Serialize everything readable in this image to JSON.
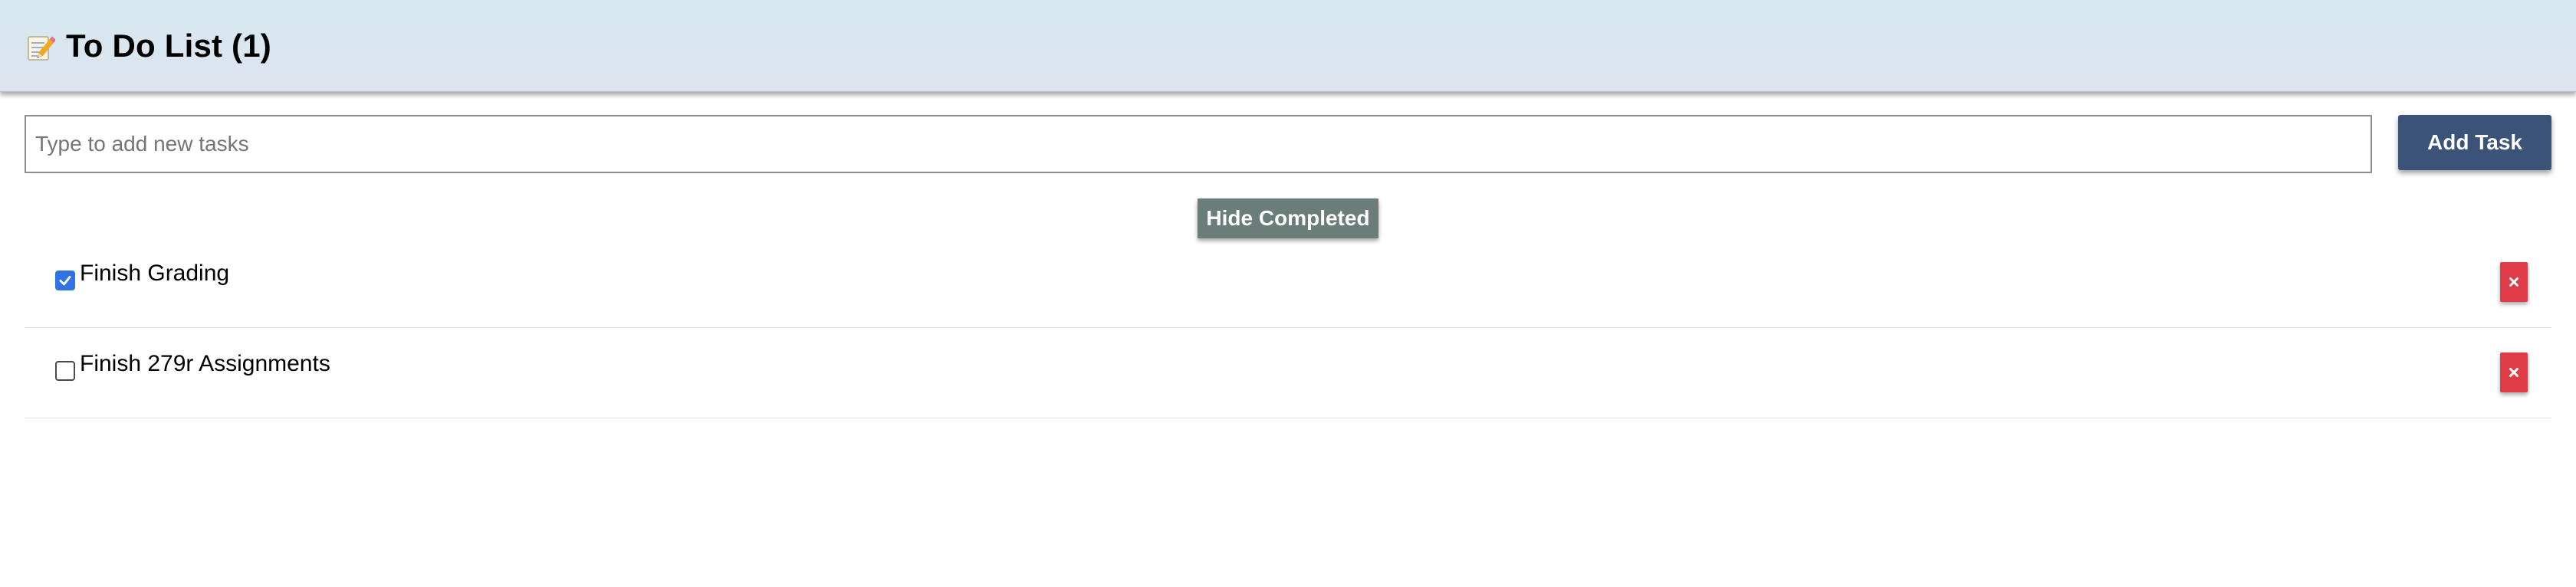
{
  "header": {
    "icon": "memo-icon",
    "title": "To Do List (1)"
  },
  "new_task": {
    "placeholder": "Type to add new tasks",
    "value": "",
    "add_label": "Add Task"
  },
  "filters": {
    "hide_completed_label": "Hide Completed"
  },
  "tasks": [
    {
      "label": "Finish Grading",
      "completed": true,
      "delete_icon": "close-icon"
    },
    {
      "label": "Finish 279r Assignments",
      "completed": false,
      "delete_icon": "close-icon"
    }
  ],
  "colors": {
    "add_button": "#3b5279",
    "hide_button": "#6b7d78",
    "delete_button": "#e03c47",
    "checkbox_checked": "#2f73e6"
  }
}
